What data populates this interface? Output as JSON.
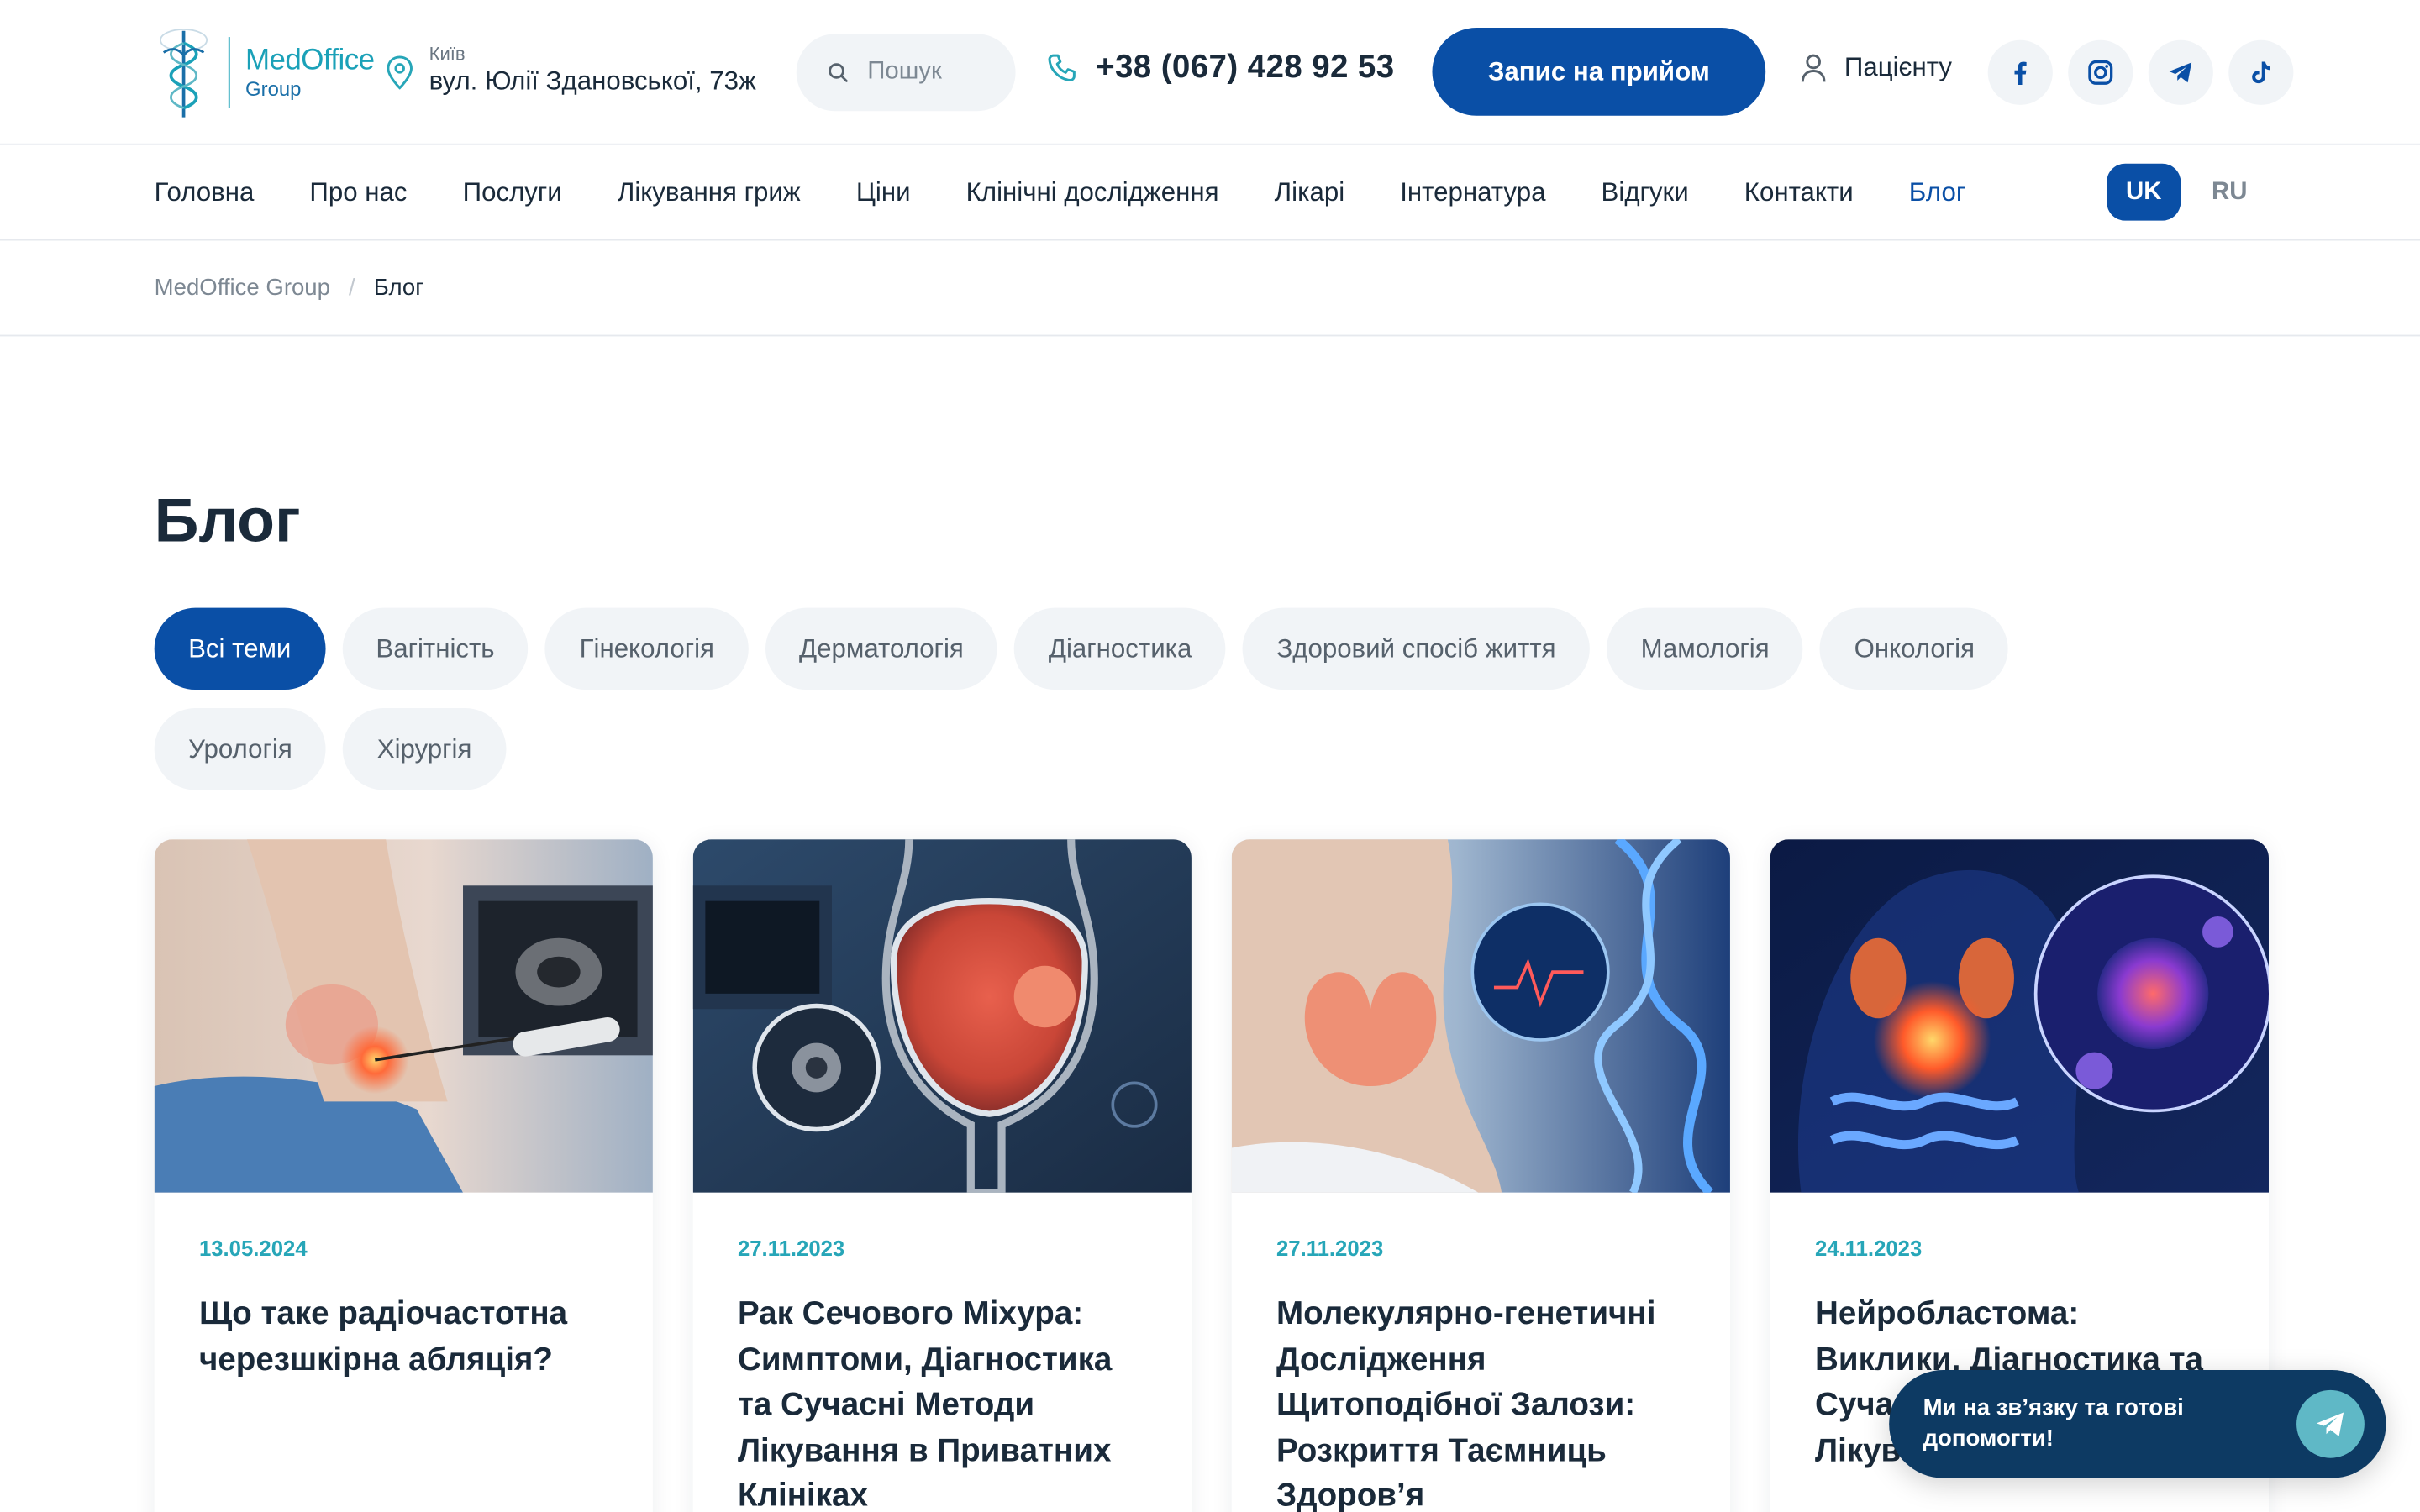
{
  "header": {
    "logo": {
      "brand": "MedOffice",
      "sub": "Group"
    },
    "address": {
      "city": "Київ",
      "street": "вул. Юлії Здановської, 73ж"
    },
    "search": {
      "placeholder": "Пошук"
    },
    "phone": "+38 (067) 428 92 53",
    "cta_label": "Запис на прийом",
    "patient_label": "Пацієнту",
    "socials": [
      "facebook-icon",
      "instagram-icon",
      "telegram-icon",
      "tiktok-icon"
    ]
  },
  "nav": {
    "items": [
      {
        "label": "Головна"
      },
      {
        "label": "Про нас"
      },
      {
        "label": "Послуги"
      },
      {
        "label": "Лікування гриж"
      },
      {
        "label": "Ціни"
      },
      {
        "label": "Клінічні дослідження"
      },
      {
        "label": "Лікарі"
      },
      {
        "label": "Інтернатура"
      },
      {
        "label": "Відгуки"
      },
      {
        "label": "Контакти"
      },
      {
        "label": "Блог",
        "active": true
      }
    ],
    "lang": {
      "active": "UK",
      "other": "RU"
    }
  },
  "breadcrumb": {
    "home": "MedOffice Group",
    "sep": "/",
    "current": "Блог"
  },
  "main": {
    "title": "Блог",
    "filters": [
      {
        "label": "Всі теми",
        "active": true
      },
      {
        "label": "Вагітність"
      },
      {
        "label": "Гінекологія"
      },
      {
        "label": "Дерматологія"
      },
      {
        "label": "Діагностика"
      },
      {
        "label": "Здоровий спосіб життя"
      },
      {
        "label": "Мамологія"
      },
      {
        "label": "Онкологія"
      },
      {
        "label": "Урологія"
      },
      {
        "label": "Хірургія"
      }
    ],
    "cards": [
      {
        "date": "13.05.2024",
        "title": "Що таке радіочастотна черезшкірна абляція?"
      },
      {
        "date": "27.11.2023",
        "title": "Рак Сечового Міхура: Симптоми, Діагностика та Сучасні Методи Лікування в Приватних Клініках"
      },
      {
        "date": "27.11.2023",
        "title": "Молекулярно-генетичні Дослідження Щитоподібної Залози: Розкриття Таємниць Здоров’я"
      },
      {
        "date": "24.11.2023",
        "title": "Нейробластома: Виклики, Діагностика та Сучасні Методи Лікування"
      }
    ]
  },
  "chat": {
    "text": "Ми на зв’язку та готові допомогти!"
  },
  "colors": {
    "primary": "#0a4fa6",
    "accent": "#27a6b8",
    "chat_bg": "#0d3a63",
    "chip_bg": "#f1f4f7"
  }
}
